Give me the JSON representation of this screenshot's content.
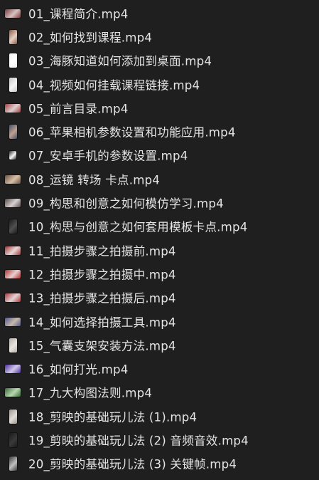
{
  "files": [
    {
      "name": "01_课程简介.mp4",
      "thumb": "landscape",
      "colors": [
        "#7a3b3b",
        "#d9c2c2"
      ]
    },
    {
      "name": "02_如何找到课程.mp4",
      "thumb": "portrait",
      "colors": [
        "#8a5a4a",
        "#e8d0c0"
      ]
    },
    {
      "name": "03_海豚知道如何添加到桌面.mp4",
      "thumb": "portrait",
      "colors": [
        "#f0f0f0",
        "#ffffff"
      ]
    },
    {
      "name": "04_视频如何挂载课程链接.mp4",
      "thumb": "portrait",
      "colors": [
        "#c8c8c8",
        "#f5f5f5"
      ]
    },
    {
      "name": "05_前言目录.mp4",
      "thumb": "landscape",
      "colors": [
        "#a04040",
        "#e0d0d0"
      ]
    },
    {
      "name": "06_苹果相机参数设置和功能应用.mp4",
      "thumb": "portrait",
      "colors": [
        "#40506a",
        "#c0a090"
      ]
    },
    {
      "name": "07_安卓手机的参数设置.mp4",
      "thumb": "small",
      "colors": [
        "#2a2a2a",
        "#f4f4f4"
      ]
    },
    {
      "name": "08_运镜 转场 卡点.mp4",
      "thumb": "landscape",
      "colors": [
        "#6a5040",
        "#d8c0a8"
      ]
    },
    {
      "name": "09_构思和创意之如何模仿学习.mp4",
      "thumb": "landscape",
      "colors": [
        "#5a4a4a",
        "#d8d0d0"
      ]
    },
    {
      "name": "10_构思与创意之如何套用模板卡点.mp4",
      "thumb": "portrait",
      "colors": [
        "#1a1a1a",
        "#505050"
      ]
    },
    {
      "name": "11_拍摄步骤之拍摄前.mp4",
      "thumb": "landscape",
      "colors": [
        "#a03838",
        "#e8d8d8"
      ]
    },
    {
      "name": "12_拍摄步骤之拍摄中.mp4",
      "thumb": "landscape",
      "colors": [
        "#b03030",
        "#e8d0d0"
      ]
    },
    {
      "name": "13_拍摄步骤之拍摄后.mp4",
      "thumb": "landscape",
      "colors": [
        "#a83a3a",
        "#e4d4d4"
      ]
    },
    {
      "name": "14_如何选择拍摄工具.mp4",
      "thumb": "landscape",
      "colors": [
        "#505890",
        "#c8b8a8"
      ]
    },
    {
      "name": "15_气囊支架安装方法.mp4",
      "thumb": "portrait",
      "colors": [
        "#b8b0a8",
        "#e8e4e0"
      ]
    },
    {
      "name": "16_如何打光.mp4",
      "thumb": "landscape",
      "colors": [
        "#5030a0",
        "#d0c8e8"
      ]
    },
    {
      "name": "17_九大构图法则.mp4",
      "thumb": "landscape",
      "colors": [
        "#3a6a3a",
        "#b8d8b0"
      ]
    },
    {
      "name": "18_剪映的基础玩儿法 (1).mp4",
      "thumb": "portrait",
      "colors": [
        "#a09890",
        "#e0dcd8"
      ]
    },
    {
      "name": "19_剪映的基础玩儿法 (2) 音频音效.mp4",
      "thumb": "portrait",
      "colors": [
        "#1a1a1a",
        "#3a3a3a"
      ]
    },
    {
      "name": "20_剪映的基础玩儿法 (3) 关键帧.mp4",
      "thumb": "portrait",
      "colors": [
        "#3a3a3a",
        "#c0c0c0"
      ]
    }
  ]
}
